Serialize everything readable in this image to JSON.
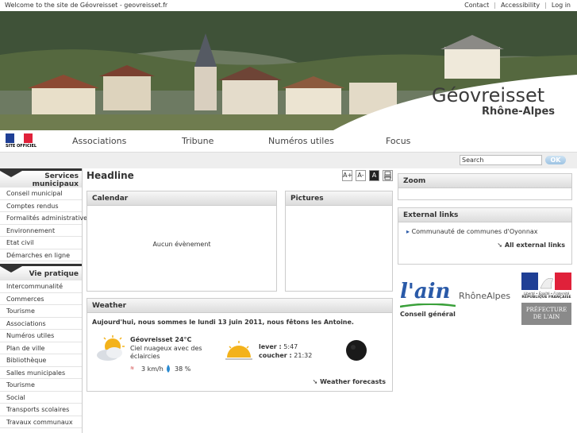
{
  "topbar": {
    "welcome": "Welcome to the site de Géovreisset - geovreisset.fr",
    "links": [
      "Contact",
      "Accessibility",
      "Log in"
    ]
  },
  "banner": {
    "title": "Géovreisset",
    "subtitle": "Rhône-Alpes"
  },
  "nav": {
    "flag_text": "SITE OFFICIEL",
    "items": [
      "Associations",
      "Tribune",
      "Numéros utiles",
      "Focus"
    ]
  },
  "search": {
    "value": "Search",
    "button": "OK"
  },
  "sidebar": {
    "section1": {
      "title_line1": "Services",
      "title_line2": "municipaux",
      "items": [
        "Conseil municipal",
        "Comptes rendus",
        "Formalités administratives",
        "Environnement",
        "Etat civil",
        "Démarches en ligne"
      ]
    },
    "section2": {
      "title": "Vie pratique",
      "items": [
        "Intercommunalité",
        "Commerces",
        "Tourisme",
        "Associations",
        "Numéros utiles",
        "Plan de ville",
        "Bibliothèque",
        "Salles municipales",
        "Tourisme",
        "Social",
        "Transports scolaires",
        "Travaux communaux"
      ]
    }
  },
  "main": {
    "headline": "Headline",
    "tools": [
      "A+",
      "A-",
      "A",
      "print"
    ],
    "calendar": {
      "title": "Calendar",
      "empty": "Aucun évènement"
    },
    "pictures": {
      "title": "Pictures"
    },
    "weather": {
      "title": "Weather",
      "intro": "Aujourd'hui, nous sommes le lundi 13 juin 2011, nous fêtons les Antoine.",
      "city_temp": "Géovreisset 24°C",
      "condition": "Ciel nuageux avec des éclaircies",
      "wind": "3 km/h",
      "humidity": "38 %",
      "sunrise_label": "lever :",
      "sunrise": "5:47",
      "sunset_label": "coucher :",
      "sunset": "21:32",
      "forecast_link": "Weather forecasts"
    }
  },
  "right": {
    "zoom": {
      "title": "Zoom"
    },
    "external": {
      "title": "External links",
      "item": "Communauté de communes d'Oyonnax",
      "all": "All external links"
    },
    "logos": {
      "ain": "l'ain",
      "ain_sub": "Conseil général",
      "rhone_alpes": "RhôneAlpes",
      "pref_motto": "Liberté • Égalité • Fraternité",
      "pref_rf": "RÉPUBLIQUE FRANÇAISE",
      "pref_line1": "PRÉFECTURE",
      "pref_line2": "DE L'AIN"
    }
  },
  "colors": {
    "accent": "#333333",
    "ok_button": "#9dc3e3",
    "link_blue": "#2a5aa8"
  }
}
